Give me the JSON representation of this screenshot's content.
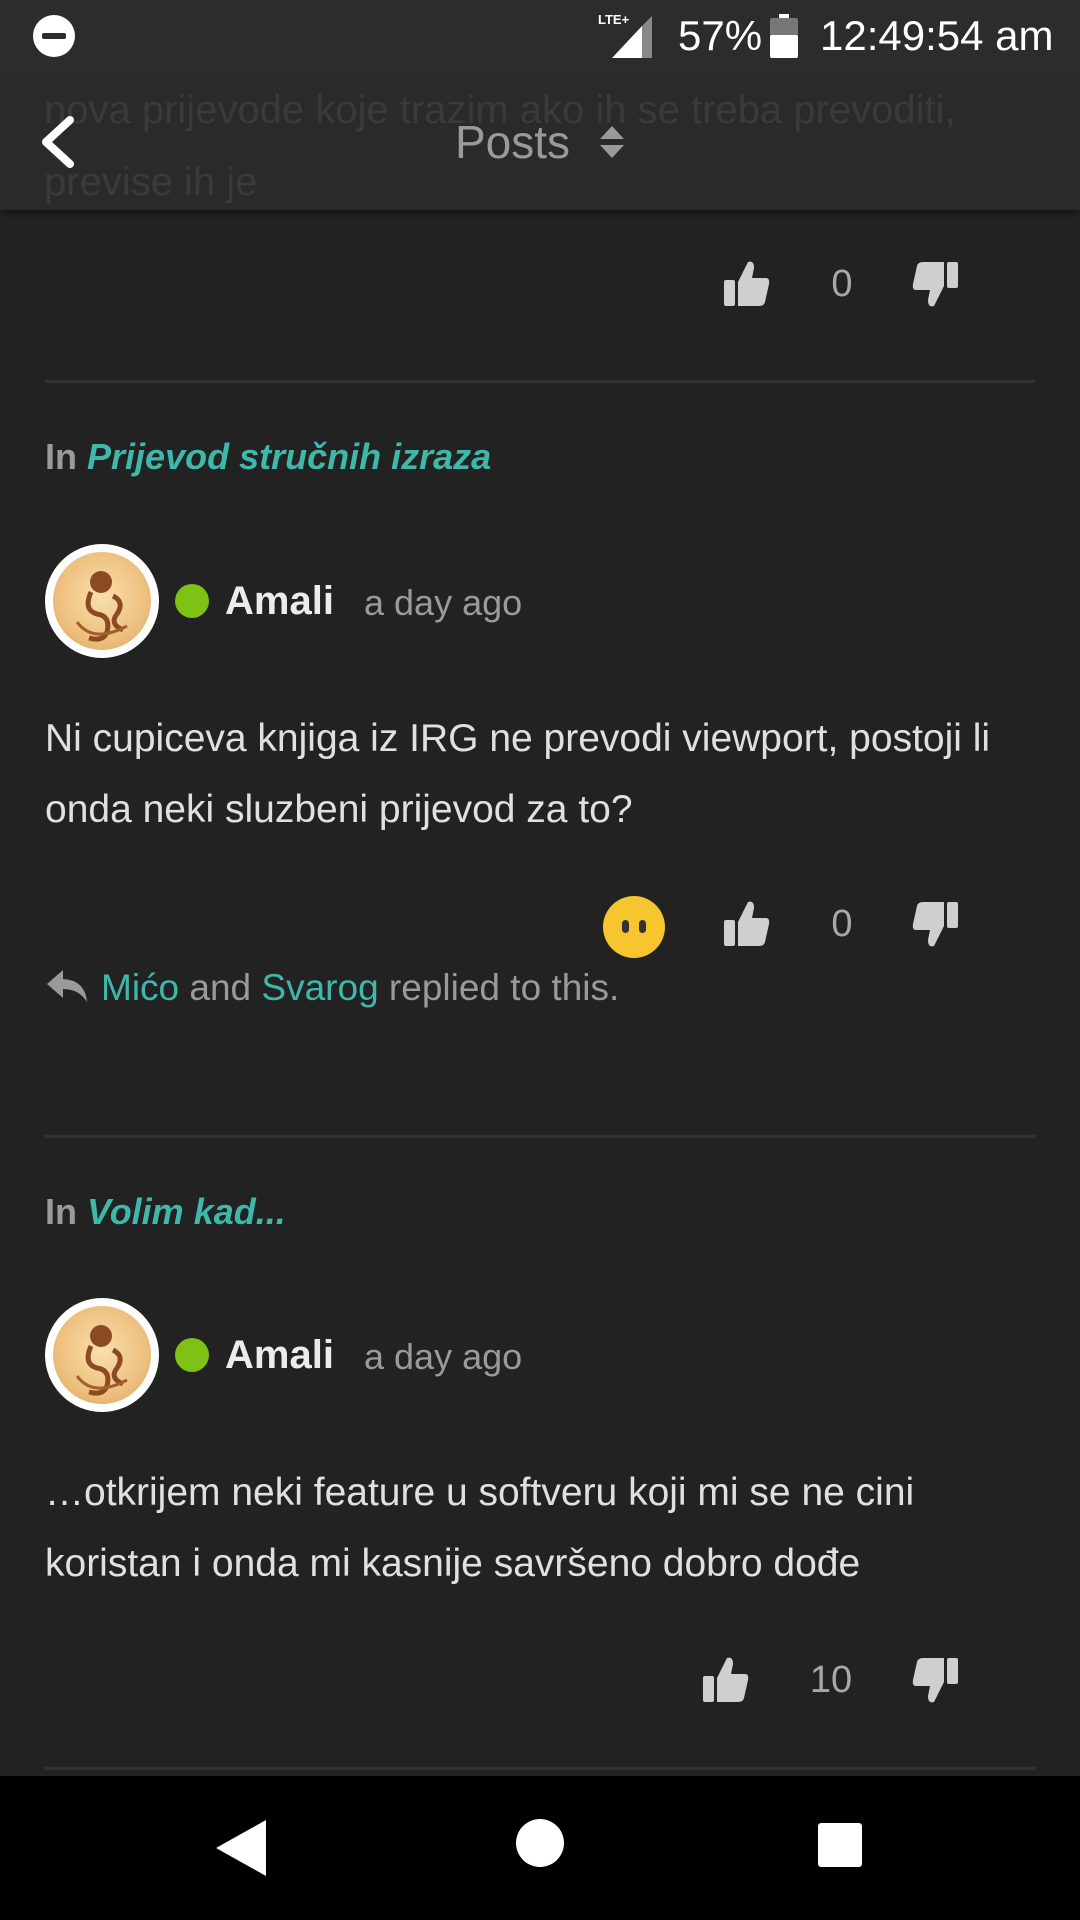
{
  "status_bar": {
    "network_label": "LTE+",
    "battery_percent": "57%",
    "time": "12:49:54 am",
    "battery_level": 0.57
  },
  "app_bar": {
    "title": "Posts",
    "scrolled_text": "nova prijevode koje trazim ako ih se treba prevoditi, previse ih je"
  },
  "posts": [
    {
      "votes": "0"
    },
    {
      "category_prefix": "In",
      "category": "Prijevod stručnih izraza",
      "author": "Amali",
      "time": "a day ago",
      "body": "Ni cupiceva knjiga iz IRG ne prevodi viewport, postoji li onda neki sluzbeni prijevod za to?",
      "votes": "0",
      "replies": {
        "user1": "Mićo",
        "conjunction": " and ",
        "user2": "Svarog",
        "suffix": " replied to this."
      }
    },
    {
      "category_prefix": "In",
      "category": "Volim kad...",
      "author": "Amali",
      "time": "a day ago",
      "body": "…otkrijem neki feature u softveru koji mi se ne cini koristan i onda mi kasnije savršeno dobro dođe",
      "votes": "10"
    }
  ],
  "colors": {
    "background": "#222222",
    "accent_link": "#3fb8ac",
    "online": "#7ec215",
    "emoji": "#f7c52e"
  },
  "icons": {
    "status": [
      "do-not-disturb-icon",
      "signal-icon",
      "battery-icon"
    ],
    "app_bar": [
      "back-arrow-icon",
      "sort-icon"
    ],
    "post": [
      "thumbs-up-icon",
      "thumbs-down-icon",
      "emoji-reaction-icon",
      "reply-icon"
    ],
    "nav": [
      "nav-back-icon",
      "nav-home-icon",
      "nav-recents-icon"
    ]
  }
}
